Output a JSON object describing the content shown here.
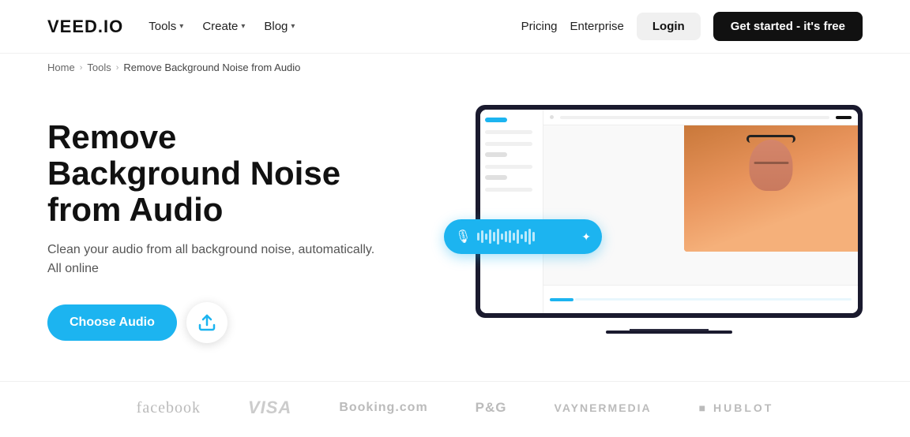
{
  "brand": {
    "name": "VEED.IO"
  },
  "nav": {
    "links": [
      {
        "label": "Tools",
        "hasDropdown": true
      },
      {
        "label": "Create",
        "hasDropdown": true
      },
      {
        "label": "Blog",
        "hasDropdown": true
      }
    ],
    "right_links": [
      {
        "label": "Pricing"
      },
      {
        "label": "Enterprise"
      }
    ],
    "login_label": "Login",
    "cta_label": "Get started - it's free"
  },
  "breadcrumb": {
    "items": [
      {
        "label": "Home",
        "href": "#"
      },
      {
        "label": "Tools",
        "href": "#"
      },
      {
        "label": "Remove Background Noise from Audio",
        "href": "#"
      }
    ]
  },
  "hero": {
    "title": "Remove Background Noise from Audio",
    "description": "Clean your audio from all background noise, automatically. All online",
    "cta_label": "Choose Audio"
  },
  "brands": [
    {
      "label": "facebook",
      "class": "fb"
    },
    {
      "label": "VISA",
      "class": "visa"
    },
    {
      "label": "Booking.com",
      "class": "booking"
    },
    {
      "label": "P&G",
      "class": "pg"
    },
    {
      "label": "VAYNER MEDIA",
      "class": "vaynermedia"
    },
    {
      "label": "■ HUBLOT",
      "class": "hublot"
    }
  ]
}
